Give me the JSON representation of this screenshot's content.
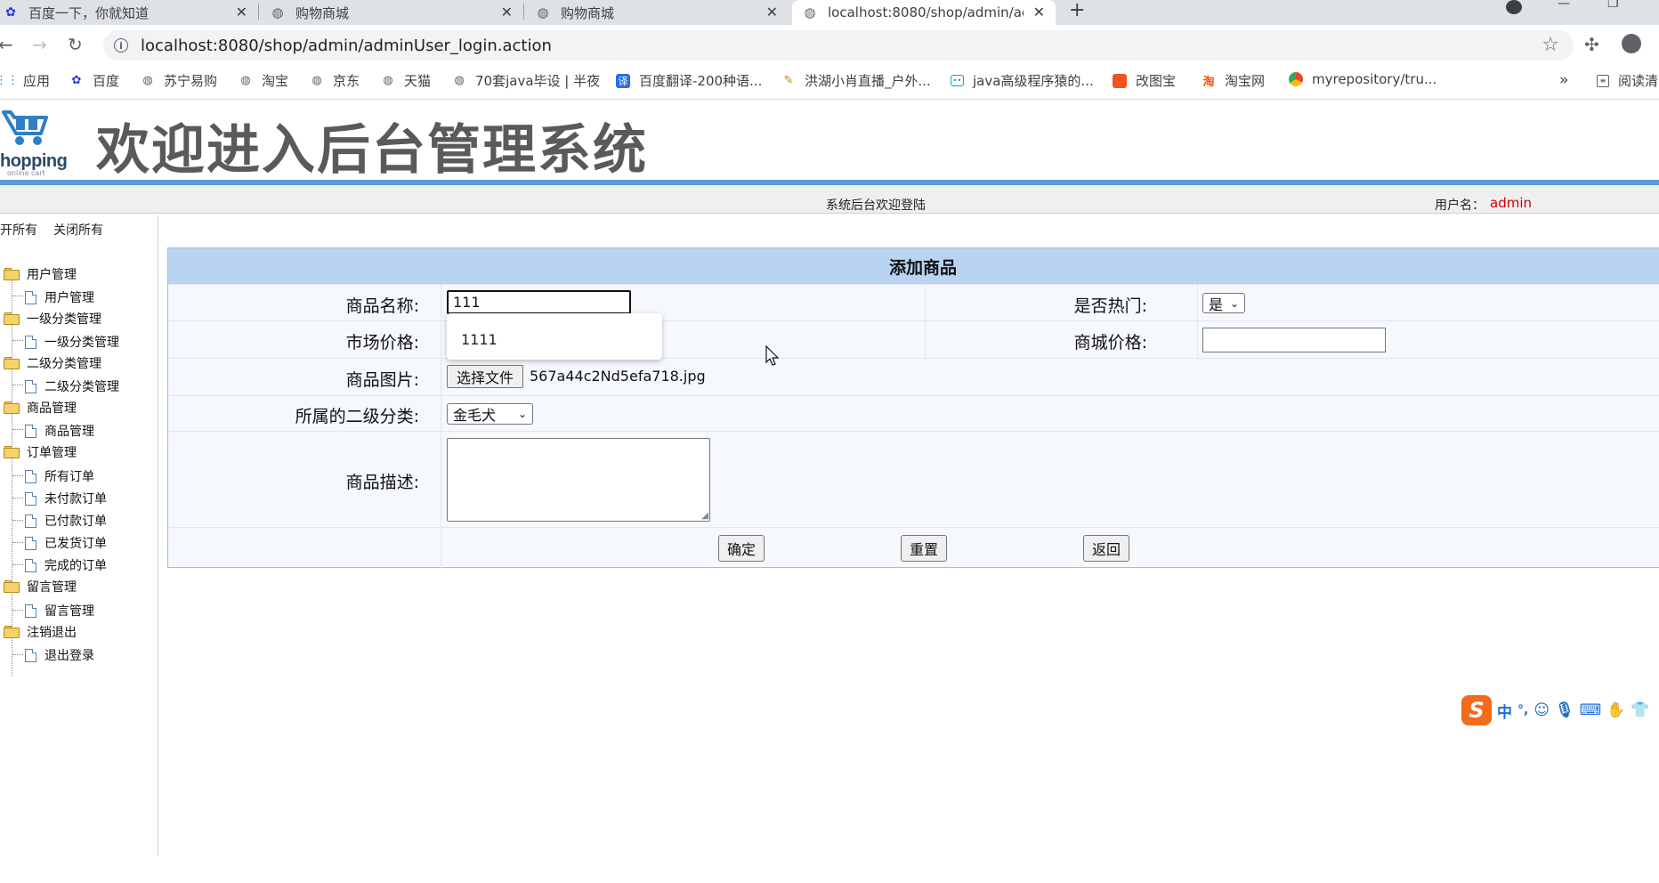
{
  "tabs": [
    {
      "title": "百度一下，你就知道"
    },
    {
      "title": "购物商城"
    },
    {
      "title": "购物商城"
    },
    {
      "title": "localhost:8080/shop/admin/ac"
    }
  ],
  "address": {
    "url": "localhost:8080/shop/admin/adminUser_login.action"
  },
  "bookmarks": [
    {
      "label": "应用"
    },
    {
      "label": "百度"
    },
    {
      "label": "苏宁易购"
    },
    {
      "label": "淘宝"
    },
    {
      "label": "京东"
    },
    {
      "label": "天猫"
    },
    {
      "label": "70套java毕设 | 半夜"
    },
    {
      "label": "百度翻译-200种语..."
    },
    {
      "label": "洪湖小肖直播_户外..."
    },
    {
      "label": "java高级程序猿的..."
    },
    {
      "label": "改图宝"
    },
    {
      "label": "淘宝网"
    },
    {
      "label": "myrepository/tru..."
    },
    {
      "label": "阅读清"
    }
  ],
  "banner": {
    "logo_word": "hopping",
    "logo_sub": "online cart",
    "title": "欢迎进入后台管理系统"
  },
  "status": {
    "welcome": "系统后台欢迎登陆",
    "username_label": "用户名：",
    "username": "admin"
  },
  "sidebar": {
    "expand_all": "开所有",
    "collapse_all": "关闭所有",
    "groups": [
      {
        "label": "用户管理",
        "items": [
          "用户管理"
        ]
      },
      {
        "label": "一级分类管理",
        "items": [
          "一级分类管理"
        ]
      },
      {
        "label": "二级分类管理",
        "items": [
          "二级分类管理"
        ]
      },
      {
        "label": "商品管理",
        "items": [
          "商品管理"
        ]
      },
      {
        "label": "订单管理",
        "items": [
          "所有订单",
          "未付款订单",
          "已付款订单",
          "已发货订单",
          "完成的订单"
        ]
      },
      {
        "label": "留言管理",
        "items": [
          "留言管理"
        ]
      },
      {
        "label": "注销退出",
        "items": [
          "退出登录"
        ]
      }
    ]
  },
  "form": {
    "title": "添加商品",
    "name_label": "商品名称:",
    "name_value": "111",
    "hot_label": "是否热门:",
    "hot_value": "是",
    "market_price_label": "市场价格:",
    "shop_price_label": "商城价格:",
    "image_label": "商品图片:",
    "file_button": "选择文件",
    "file_name": "567a44c2Nd5efa718.jpg",
    "category_label": "所属的二级分类:",
    "category_value": "金毛犬",
    "desc_label": "商品描述:",
    "submit": "确定",
    "reset": "重置",
    "back": "返回",
    "autocomplete_option": "1111"
  },
  "ime": {
    "mode": "中",
    "punct": "°,"
  }
}
